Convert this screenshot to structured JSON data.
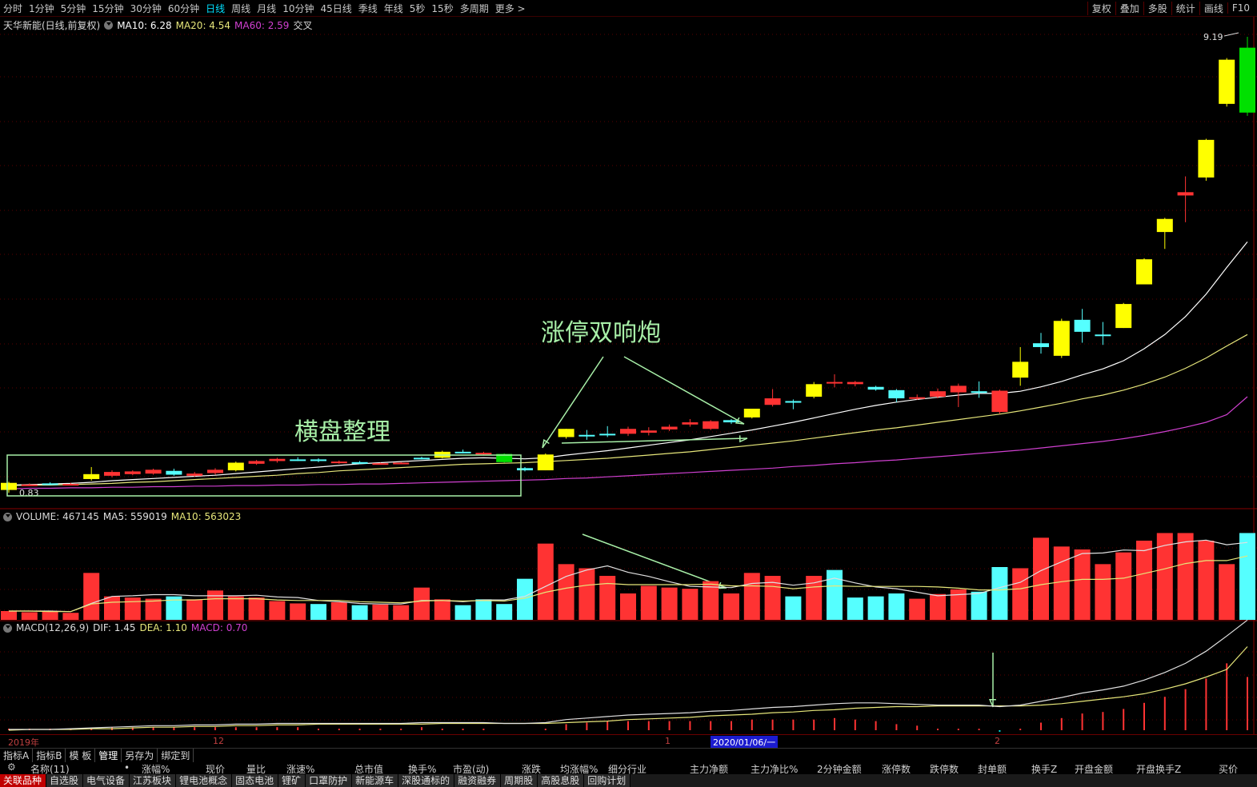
{
  "top_periods": [
    "分时",
    "1分钟",
    "5分钟",
    "15分钟",
    "30分钟",
    "60分钟",
    "日线",
    "周线",
    "月线",
    "10分钟",
    "45日线",
    "季线",
    "年线",
    "5秒",
    "15秒",
    "多周期",
    "更多 >"
  ],
  "active_period": "日线",
  "right_tools": [
    "复权",
    "叠加",
    "多股",
    "统计",
    "画线",
    "F10"
  ],
  "stock": {
    "name": "天华新能(日线,前复权)",
    "ma10": "MA10: 6.28",
    "ma20": "MA20: 4.54",
    "ma60": "MA60: 2.59",
    "cross": "交叉"
  },
  "price_axis": {
    "high_label": "9.19",
    "low_label": "0.83"
  },
  "annotations": {
    "consolidation": "横盘整理",
    "double_limit": "涨停双响炮"
  },
  "volume": {
    "label": "VOLUME: 467145",
    "ma5": "MA5: 559019",
    "ma10": "MA10: 563023"
  },
  "macd": {
    "label": "MACD(12,26,9)",
    "dif": "DIF: 1.45",
    "dea": "DEA: 1.10",
    "macd": "MACD: 0.70"
  },
  "date_axis": {
    "year": "2019年",
    "m12": "12",
    "m1": "1",
    "selected": "2020/01/06/一",
    "m2": "2"
  },
  "tool_buttons": [
    "指标A",
    "指标B",
    "模 板",
    "管理",
    "另存为",
    "绑定到"
  ],
  "active_tool": "管理",
  "columns": [
    "名称(11)",
    "•",
    "涨幅%",
    "现价",
    "量比",
    "涨速%",
    "总市值",
    "换手%",
    "市盈(动)",
    "涨跌",
    "均涨幅%",
    "细分行业",
    "主力净额",
    "主力净比%",
    "2分钟金额",
    "涨停数",
    "跌停数",
    "封单额",
    "换手Z",
    "开盘金额",
    "开盘换手Z",
    "买价"
  ],
  "tabs": [
    "关联品种",
    "自选股",
    "电气设备",
    "江苏板块",
    "锂电池概念",
    "固态电池",
    "锂矿",
    "口罩防护",
    "新能源车",
    "深股通标的",
    "融资融券",
    "周期股",
    "高股息股",
    "回购计划"
  ],
  "colors": {
    "up": "#ff3333",
    "up_limit": "#ffff00",
    "down": "#55ffff",
    "down_limit": "#00e000",
    "ma10": "#ffffff",
    "ma20": "#e6e67a",
    "ma60": "#d040d0",
    "annotation": "#a8f0a8"
  },
  "chart_data": {
    "type": "candlestick",
    "title": "天华新能(日线,前复权)",
    "price_range": [
      0.83,
      9.19
    ],
    "candles": [
      {
        "o": 0.88,
        "c": 1.01,
        "h": 1.03,
        "l": 0.83,
        "t": "limit"
      },
      {
        "o": 0.97,
        "c": 0.98,
        "h": 1.0,
        "l": 0.96,
        "t": "up"
      },
      {
        "o": 0.99,
        "c": 1.0,
        "h": 1.02,
        "l": 0.97,
        "t": "down"
      },
      {
        "o": 0.98,
        "c": 0.99,
        "h": 1.01,
        "l": 0.97,
        "t": "up"
      },
      {
        "o": 1.08,
        "c": 1.17,
        "h": 1.3,
        "l": 1.05,
        "t": "limit"
      },
      {
        "o": 1.14,
        "c": 1.21,
        "h": 1.24,
        "l": 1.11,
        "t": "up"
      },
      {
        "o": 1.17,
        "c": 1.22,
        "h": 1.24,
        "l": 1.15,
        "t": "up"
      },
      {
        "o": 1.18,
        "c": 1.25,
        "h": 1.27,
        "l": 1.16,
        "t": "up"
      },
      {
        "o": 1.23,
        "c": 1.16,
        "h": 1.27,
        "l": 1.14,
        "t": "down"
      },
      {
        "o": 1.14,
        "c": 1.18,
        "h": 1.21,
        "l": 1.12,
        "t": "up"
      },
      {
        "o": 1.19,
        "c": 1.25,
        "h": 1.28,
        "l": 1.16,
        "t": "up"
      },
      {
        "o": 1.24,
        "c": 1.38,
        "h": 1.4,
        "l": 1.22,
        "t": "limit"
      },
      {
        "o": 1.36,
        "c": 1.41,
        "h": 1.43,
        "l": 1.34,
        "t": "up"
      },
      {
        "o": 1.41,
        "c": 1.45,
        "h": 1.47,
        "l": 1.38,
        "t": "up"
      },
      {
        "o": 1.43,
        "c": 1.44,
        "h": 1.48,
        "l": 1.41,
        "t": "down"
      },
      {
        "o": 1.44,
        "c": 1.41,
        "h": 1.46,
        "l": 1.39,
        "t": "down"
      },
      {
        "o": 1.38,
        "c": 1.4,
        "h": 1.42,
        "l": 1.36,
        "t": "up"
      },
      {
        "o": 1.39,
        "c": 1.36,
        "h": 1.41,
        "l": 1.35,
        "t": "down"
      },
      {
        "o": 1.36,
        "c": 1.37,
        "h": 1.38,
        "l": 1.35,
        "t": "up"
      },
      {
        "o": 1.37,
        "c": 1.38,
        "h": 1.39,
        "l": 1.36,
        "t": "up"
      },
      {
        "o": 1.45,
        "c": 1.47,
        "h": 1.49,
        "l": 1.44,
        "t": "down"
      },
      {
        "o": 1.47,
        "c": 1.58,
        "h": 1.6,
        "l": 1.46,
        "t": "limit"
      },
      {
        "o": 1.58,
        "c": 1.57,
        "h": 1.62,
        "l": 1.55,
        "t": "down"
      },
      {
        "o": 1.56,
        "c": 1.54,
        "h": 1.58,
        "l": 1.52,
        "t": "up"
      },
      {
        "o": 1.54,
        "c": 1.39,
        "h": 1.55,
        "l": 1.38,
        "t": "down_limit"
      },
      {
        "o": 1.28,
        "c": 1.24,
        "h": 1.3,
        "l": 1.22,
        "t": "down"
      },
      {
        "o": 1.24,
        "c": 1.53,
        "h": 1.55,
        "l": 1.24,
        "t": "limit"
      },
      {
        "o": 1.85,
        "c": 2.0,
        "h": 2.0,
        "l": 1.82,
        "t": "limit"
      },
      {
        "o": 1.88,
        "c": 1.89,
        "h": 1.98,
        "l": 1.8,
        "t": "down"
      },
      {
        "o": 1.9,
        "c": 1.91,
        "h": 2.05,
        "l": 1.85,
        "t": "down"
      },
      {
        "o": 1.91,
        "c": 2.0,
        "h": 2.04,
        "l": 1.87,
        "t": "up"
      },
      {
        "o": 1.93,
        "c": 1.97,
        "h": 2.03,
        "l": 1.88,
        "t": "up"
      },
      {
        "o": 1.99,
        "c": 2.04,
        "h": 2.08,
        "l": 1.96,
        "t": "up"
      },
      {
        "o": 2.08,
        "c": 2.12,
        "h": 2.18,
        "l": 2.04,
        "t": "up"
      },
      {
        "o": 2.0,
        "c": 2.14,
        "h": 2.16,
        "l": 1.98,
        "t": "up"
      },
      {
        "o": 2.12,
        "c": 2.16,
        "h": 2.18,
        "l": 2.09,
        "t": "down"
      },
      {
        "o": 2.21,
        "c": 2.37,
        "h": 2.37,
        "l": 2.19,
        "t": "limit"
      },
      {
        "o": 2.44,
        "c": 2.56,
        "h": 2.73,
        "l": 2.41,
        "t": "up"
      },
      {
        "o": 2.51,
        "c": 2.48,
        "h": 2.54,
        "l": 2.36,
        "t": "down"
      },
      {
        "o": 2.59,
        "c": 2.82,
        "h": 2.86,
        "l": 2.56,
        "t": "limit"
      },
      {
        "o": 2.86,
        "c": 2.84,
        "h": 3.0,
        "l": 2.76,
        "t": "up"
      },
      {
        "o": 2.86,
        "c": 2.82,
        "h": 2.88,
        "l": 2.78,
        "t": "up"
      },
      {
        "o": 2.77,
        "c": 2.72,
        "h": 2.79,
        "l": 2.7,
        "t": "down"
      },
      {
        "o": 2.71,
        "c": 2.56,
        "h": 2.73,
        "l": 2.49,
        "t": "down"
      },
      {
        "o": 2.57,
        "c": 2.58,
        "h": 2.63,
        "l": 2.53,
        "t": "up"
      },
      {
        "o": 2.59,
        "c": 2.69,
        "h": 2.74,
        "l": 2.56,
        "t": "up"
      },
      {
        "o": 2.67,
        "c": 2.79,
        "h": 2.83,
        "l": 2.4,
        "t": "up"
      },
      {
        "o": 2.69,
        "c": 2.66,
        "h": 2.87,
        "l": 2.57,
        "t": "down"
      },
      {
        "o": 2.7,
        "c": 2.31,
        "h": 2.72,
        "l": 2.28,
        "t": "up"
      },
      {
        "o": 2.94,
        "c": 3.23,
        "h": 3.5,
        "l": 2.79,
        "t": "limit"
      },
      {
        "o": 3.5,
        "c": 3.57,
        "h": 3.76,
        "l": 3.38,
        "t": "down"
      },
      {
        "o": 3.34,
        "c": 3.98,
        "h": 4.02,
        "l": 3.3,
        "t": "limit"
      },
      {
        "o": 3.78,
        "c": 4.0,
        "h": 4.2,
        "l": 3.58,
        "t": "down"
      },
      {
        "o": 3.72,
        "c": 3.73,
        "h": 3.96,
        "l": 3.54,
        "t": "down"
      },
      {
        "o": 3.85,
        "c": 4.29,
        "h": 4.31,
        "l": 3.85,
        "t": "limit"
      },
      {
        "o": 4.65,
        "c": 5.11,
        "h": 5.13,
        "l": 4.65,
        "t": "limit"
      },
      {
        "o": 5.61,
        "c": 5.85,
        "h": 5.87,
        "l": 5.3,
        "t": "limit"
      },
      {
        "o": 6.28,
        "c": 6.34,
        "h": 6.63,
        "l": 5.79,
        "t": "up"
      },
      {
        "o": 6.61,
        "c": 7.3,
        "h": 7.32,
        "l": 6.55,
        "t": "limit"
      },
      {
        "o": 7.96,
        "c": 8.77,
        "h": 8.8,
        "l": 7.91,
        "t": "limit"
      },
      {
        "o": 8.99,
        "c": 7.8,
        "h": 9.19,
        "l": 7.74,
        "t": "down_limit"
      }
    ],
    "ma10": [
      0.97,
      0.98,
      0.99,
      1.0,
      1.02,
      1.05,
      1.07,
      1.09,
      1.11,
      1.13,
      1.15,
      1.18,
      1.21,
      1.24,
      1.27,
      1.3,
      1.33,
      1.36,
      1.38,
      1.4,
      1.42,
      1.44,
      1.46,
      1.47,
      1.46,
      1.45,
      1.47,
      1.52,
      1.56,
      1.6,
      1.65,
      1.7,
      1.75,
      1.8,
      1.86,
      1.92,
      1.98,
      2.05,
      2.12,
      2.2,
      2.28,
      2.36,
      2.43,
      2.49,
      2.54,
      2.58,
      2.62,
      2.65,
      2.65,
      2.69,
      2.77,
      2.87,
      2.99,
      3.1,
      3.25,
      3.47,
      3.73,
      4.06,
      4.47,
      4.96,
      5.43
    ],
    "ma20": [
      0.96,
      0.97,
      0.97,
      0.98,
      0.99,
      1.0,
      1.02,
      1.03,
      1.05,
      1.07,
      1.09,
      1.11,
      1.13,
      1.15,
      1.18,
      1.2,
      1.23,
      1.25,
      1.27,
      1.29,
      1.31,
      1.33,
      1.35,
      1.36,
      1.37,
      1.38,
      1.4,
      1.42,
      1.44,
      1.46,
      1.49,
      1.52,
      1.55,
      1.58,
      1.62,
      1.66,
      1.7,
      1.74,
      1.78,
      1.83,
      1.88,
      1.93,
      1.98,
      2.02,
      2.07,
      2.12,
      2.17,
      2.22,
      2.27,
      2.33,
      2.4,
      2.47,
      2.55,
      2.62,
      2.71,
      2.82,
      2.95,
      3.11,
      3.3,
      3.52,
      3.73
    ],
    "ma60": [
      0.9,
      0.91,
      0.91,
      0.92,
      0.92,
      0.93,
      0.93,
      0.94,
      0.94,
      0.95,
      0.95,
      0.96,
      0.96,
      0.97,
      0.97,
      0.98,
      0.98,
      0.99,
      0.99,
      1.0,
      1.01,
      1.02,
      1.03,
      1.04,
      1.05,
      1.06,
      1.07,
      1.09,
      1.1,
      1.12,
      1.14,
      1.16,
      1.18,
      1.2,
      1.22,
      1.24,
      1.26,
      1.28,
      1.31,
      1.33,
      1.36,
      1.38,
      1.41,
      1.43,
      1.46,
      1.49,
      1.52,
      1.55,
      1.58,
      1.61,
      1.65,
      1.69,
      1.73,
      1.77,
      1.82,
      1.88,
      1.95,
      2.03,
      2.12,
      2.26,
      2.59
    ],
    "volume": [
      15,
      13,
      14,
      12,
      80,
      40,
      38,
      36,
      40,
      35,
      50,
      40,
      38,
      32,
      28,
      27,
      30,
      25,
      26,
      25,
      55,
      35,
      25,
      35,
      27,
      70,
      130,
      95,
      88,
      75,
      45,
      58,
      55,
      53,
      66,
      45,
      80,
      75,
      40,
      75,
      85,
      38,
      40,
      45,
      36,
      44,
      52,
      48,
      90,
      88,
      140,
      125,
      120,
      95,
      115,
      135,
      148,
      148,
      135,
      95,
      148
    ],
    "volume_ma5": [
      15,
      15,
      15,
      14,
      28,
      40,
      41,
      43,
      43,
      41,
      41,
      41,
      42,
      39,
      38,
      33,
      31,
      28,
      27,
      27,
      33,
      33,
      31,
      34,
      34,
      40,
      57,
      74,
      85,
      92,
      81,
      74,
      65,
      57,
      56,
      55,
      62,
      64,
      59,
      63,
      71,
      63,
      56,
      53,
      47,
      41,
      43,
      45,
      55,
      64,
      84,
      99,
      113,
      114,
      119,
      118,
      127,
      133,
      136,
      128,
      132
    ],
    "volume_ma10": [
      15,
      15,
      14,
      14,
      27,
      30,
      31,
      32,
      34,
      34,
      36,
      36,
      36,
      34,
      33,
      33,
      33,
      31,
      30,
      29,
      32,
      33,
      32,
      33,
      32,
      37,
      47,
      54,
      59,
      62,
      60,
      60,
      60,
      60,
      61,
      58,
      58,
      57,
      53,
      56,
      58,
      57,
      57,
      57,
      57,
      56,
      54,
      51,
      51,
      53,
      60,
      65,
      69,
      69,
      71,
      79,
      87,
      96,
      101,
      101,
      109
    ],
    "macd_dif": [
      0.01,
      0.01,
      0.01,
      0.02,
      0.03,
      0.04,
      0.05,
      0.06,
      0.06,
      0.07,
      0.07,
      0.08,
      0.08,
      0.09,
      0.09,
      0.09,
      0.09,
      0.09,
      0.09,
      0.09,
      0.1,
      0.1,
      0.1,
      0.1,
      0.09,
      0.09,
      0.1,
      0.14,
      0.16,
      0.18,
      0.2,
      0.21,
      0.22,
      0.23,
      0.25,
      0.26,
      0.28,
      0.3,
      0.31,
      0.33,
      0.35,
      0.36,
      0.36,
      0.35,
      0.34,
      0.33,
      0.33,
      0.33,
      0.31,
      0.33,
      0.38,
      0.43,
      0.49,
      0.53,
      0.58,
      0.66,
      0.76,
      0.88,
      1.04,
      1.24,
      1.45
    ],
    "macd_dea": [
      0.0,
      0.01,
      0.01,
      0.01,
      0.02,
      0.02,
      0.03,
      0.04,
      0.04,
      0.05,
      0.05,
      0.06,
      0.06,
      0.07,
      0.07,
      0.08,
      0.08,
      0.08,
      0.08,
      0.08,
      0.08,
      0.09,
      0.09,
      0.09,
      0.09,
      0.09,
      0.09,
      0.1,
      0.11,
      0.12,
      0.14,
      0.15,
      0.16,
      0.17,
      0.19,
      0.2,
      0.21,
      0.23,
      0.24,
      0.26,
      0.27,
      0.29,
      0.3,
      0.31,
      0.31,
      0.32,
      0.32,
      0.32,
      0.32,
      0.32,
      0.33,
      0.35,
      0.38,
      0.41,
      0.44,
      0.48,
      0.54,
      0.61,
      0.7,
      0.8,
      1.1
    ],
    "macd_hist": [
      0.02,
      0.02,
      0.02,
      0.02,
      0.02,
      0.04,
      0.04,
      0.04,
      0.04,
      0.04,
      0.04,
      0.04,
      0.04,
      0.04,
      0.04,
      0.02,
      0.02,
      0.02,
      0.02,
      0.02,
      0.04,
      0.02,
      0.02,
      0.02,
      0.0,
      0.0,
      0.02,
      0.08,
      0.1,
      0.12,
      0.12,
      0.12,
      0.12,
      0.12,
      0.12,
      0.12,
      0.14,
      0.14,
      0.14,
      0.14,
      0.16,
      0.14,
      0.12,
      0.08,
      0.06,
      0.02,
      0.02,
      0.02,
      -0.02,
      0.02,
      0.1,
      0.16,
      0.22,
      0.24,
      0.28,
      0.36,
      0.44,
      0.54,
      0.68,
      0.88,
      0.7
    ]
  }
}
